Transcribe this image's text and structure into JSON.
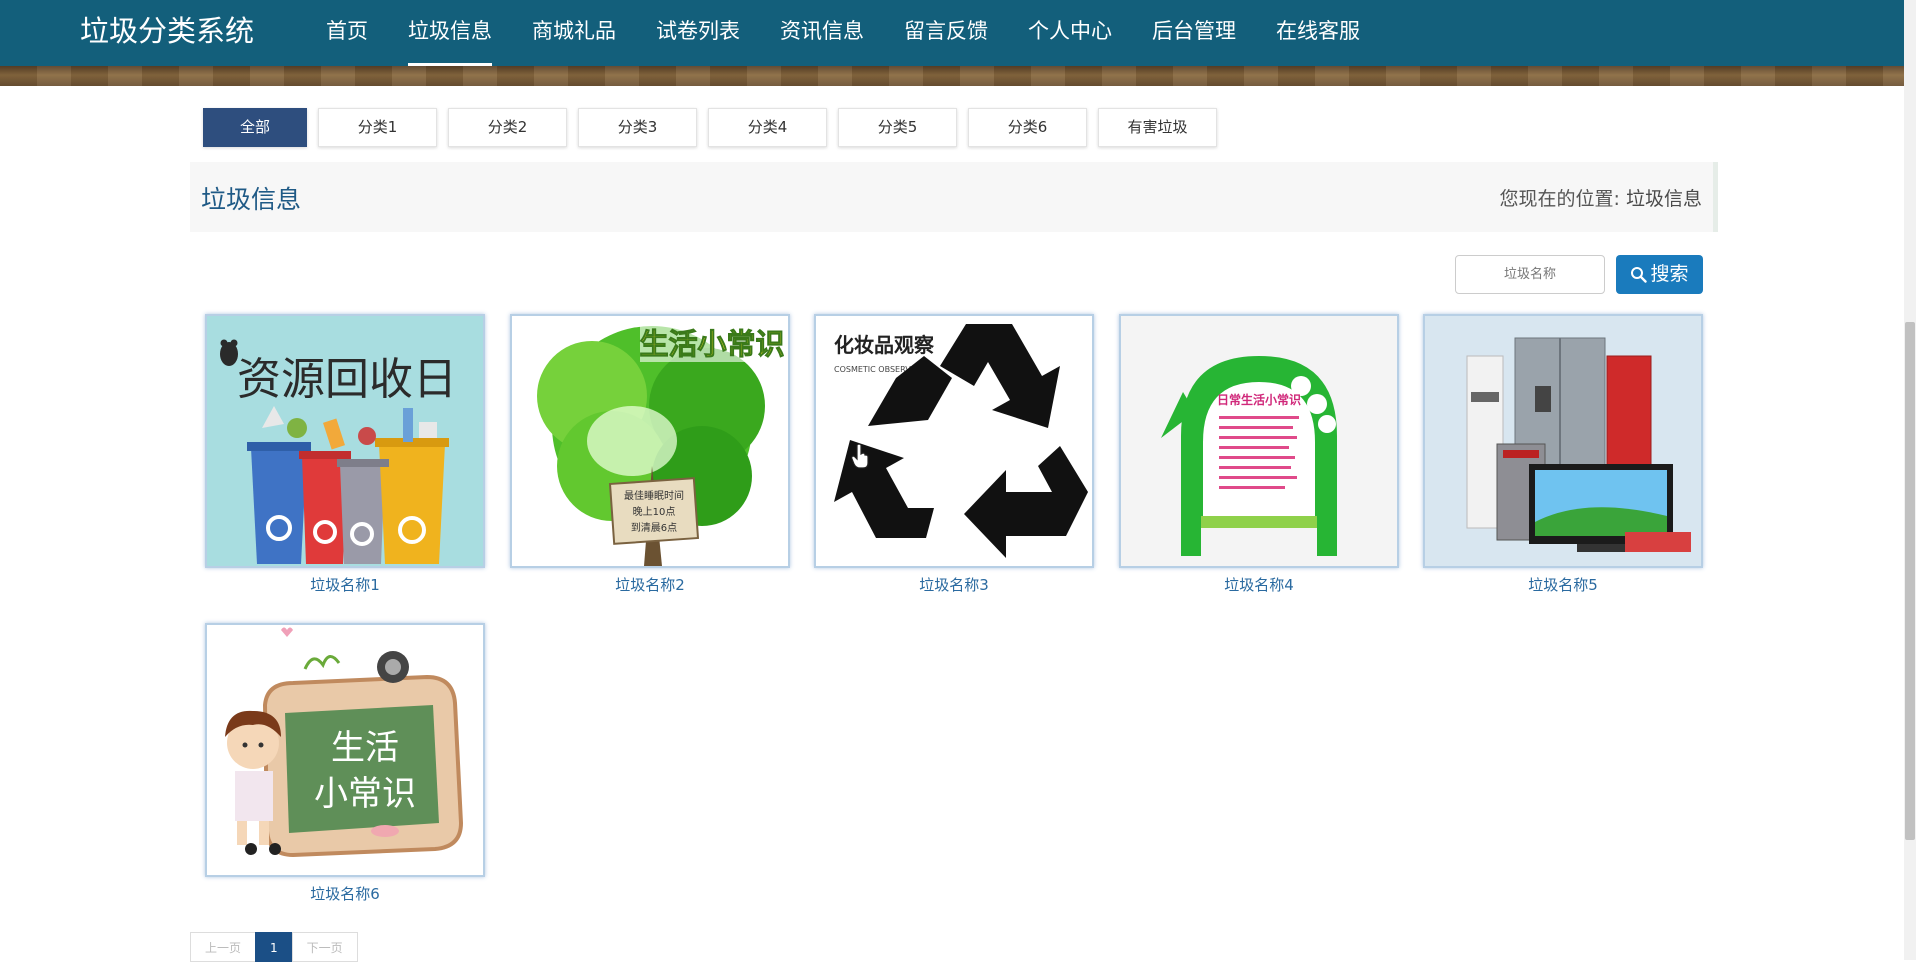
{
  "header": {
    "brand": "垃圾分类系统",
    "nav": [
      "首页",
      "垃圾信息",
      "商城礼品",
      "试卷列表",
      "资讯信息",
      "留言反馈",
      "个人中心",
      "后台管理",
      "在线客服"
    ],
    "active_nav": "垃圾信息"
  },
  "categories": [
    "全部",
    "分类1",
    "分类2",
    "分类3",
    "分类4",
    "分类5",
    "分类6",
    "有害垃圾"
  ],
  "active_category": "全部",
  "titlebar": {
    "title": "垃圾信息",
    "breadcrumb_prefix": "您现在的位置:",
    "breadcrumb_current": "垃圾信息"
  },
  "search": {
    "placeholder": "垃圾名称",
    "button_label": "搜索"
  },
  "items": [
    {
      "name": "垃圾名称1",
      "image_text": "资源回收日"
    },
    {
      "name": "垃圾名称2",
      "image_text": "生活小常识",
      "image_sign": [
        "最佳睡眠时间",
        "晚上10点",
        "到清晨6点"
      ]
    },
    {
      "name": "垃圾名称3",
      "image_text": "化妆品观察",
      "image_sub": "COSMETIC OBSERVE"
    },
    {
      "name": "垃圾名称4",
      "image_text": "日常生活小常识"
    },
    {
      "name": "垃圾名称5"
    },
    {
      "name": "垃圾名称6",
      "image_text": [
        "生活",
        "小常识"
      ]
    }
  ],
  "pagination": {
    "prev": "上一页",
    "current": "1",
    "next": "下一页"
  },
  "colors": {
    "header_bg": "#135f7b",
    "active_tab": "#2e4e7e",
    "search_button": "#1a7bbd",
    "link": "#2a6aa0"
  }
}
